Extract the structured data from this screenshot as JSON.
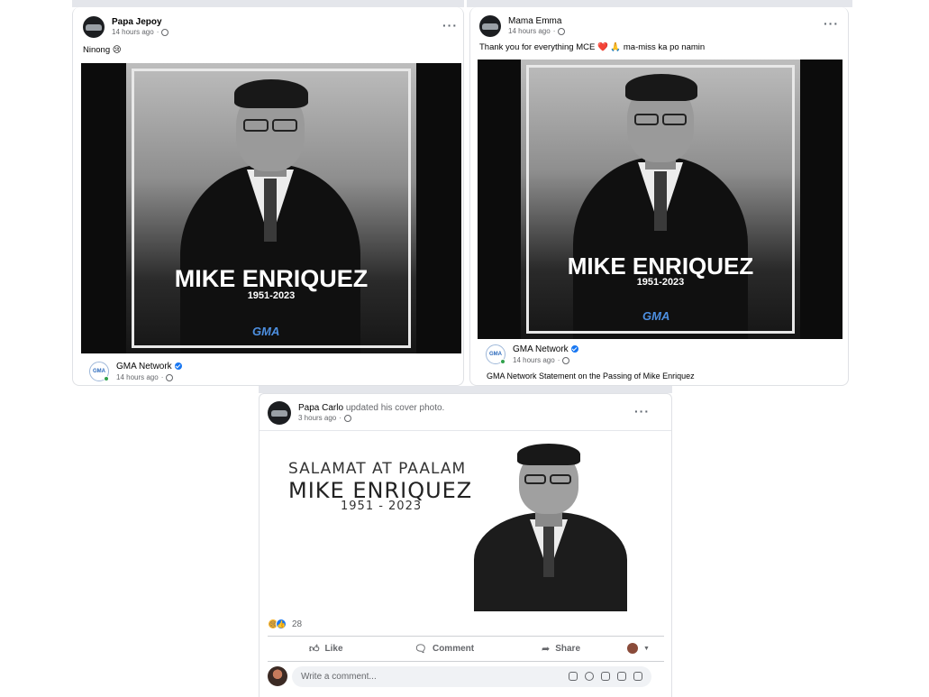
{
  "post1": {
    "author": "Papa Jepoy",
    "time": "14 hours ago",
    "caption": "Ninong 😢",
    "poster_title": "MIKE ENRIQUEZ",
    "poster_years": "1951-2023",
    "logo": "GMA",
    "shared_page": "GMA Network",
    "shared_time": "14 hours ago"
  },
  "post2": {
    "author": "Mama Emma",
    "time": "14 hours ago",
    "caption": "Thank you for everything MCE ❤️ 🙏 ma-miss ka po namin",
    "poster_title": "MIKE ENRIQUEZ",
    "poster_years": "1951-2023",
    "logo": "GMA",
    "shared_page": "GMA Network",
    "shared_time": "14 hours ago",
    "shared_caption": "GMA Network Statement on the Passing of Mike Enriquez"
  },
  "post3": {
    "author": "Papa Carlo",
    "action": "updated his cover photo.",
    "time": "3 hours ago",
    "cover_line1": "SALAMAT AT PAALAM",
    "cover_line2": "MIKE  ENRIQUEZ",
    "cover_line3": "1951 - 2023",
    "reaction_count": "28",
    "like_label": "Like",
    "comment_label": "Comment",
    "share_label": "Share",
    "comment_placeholder": "Write a comment..."
  },
  "icons": {
    "more": "more-options-icon",
    "globe": "globe-icon",
    "verified": "verified-badge-icon",
    "like": "thumbs-up-icon",
    "comment": "speech-bubble-icon",
    "share": "share-arrow-icon"
  },
  "colors": {
    "facebook_blue": "#1877f2",
    "meta_gray": "#65676b",
    "online_green": "#31a24c"
  }
}
